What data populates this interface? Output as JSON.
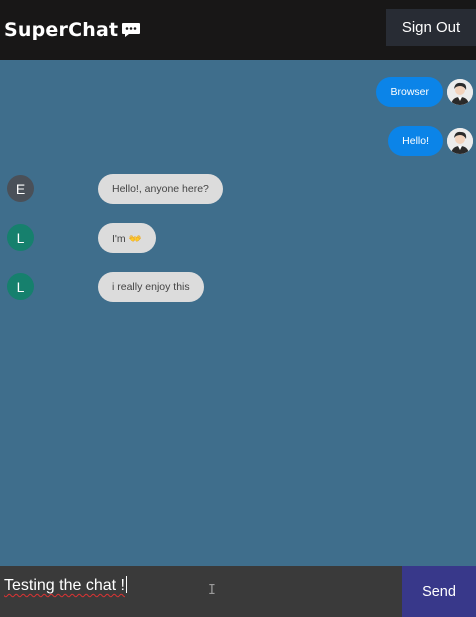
{
  "header": {
    "title": "SuperChat",
    "title_icon": "chat-bubble-icon",
    "signout_label": "Sign Out"
  },
  "messages": [
    {
      "direction": "sent",
      "text": "Browser",
      "avatar": "user-photo"
    },
    {
      "direction": "sent",
      "text": "Hello!",
      "avatar": "user-photo"
    },
    {
      "direction": "received",
      "text": "Hello!, anyone here?",
      "avatar_letter": "E",
      "avatar_color": "#4a5058"
    },
    {
      "direction": "received",
      "text": "I'm 👐",
      "avatar_letter": "L",
      "avatar_color": "#16806d"
    },
    {
      "direction": "received",
      "text": "i really enjoy this",
      "avatar_letter": "L",
      "avatar_color": "#16806d"
    }
  ],
  "composer": {
    "value": "Testing the chat !",
    "send_label": "Send"
  },
  "colors": {
    "header_bg": "#181717",
    "chat_bg": "#3f6e8c",
    "sent_bubble": "#0b84e8",
    "received_bubble": "#dcdcdc",
    "send_button": "#38388a"
  }
}
